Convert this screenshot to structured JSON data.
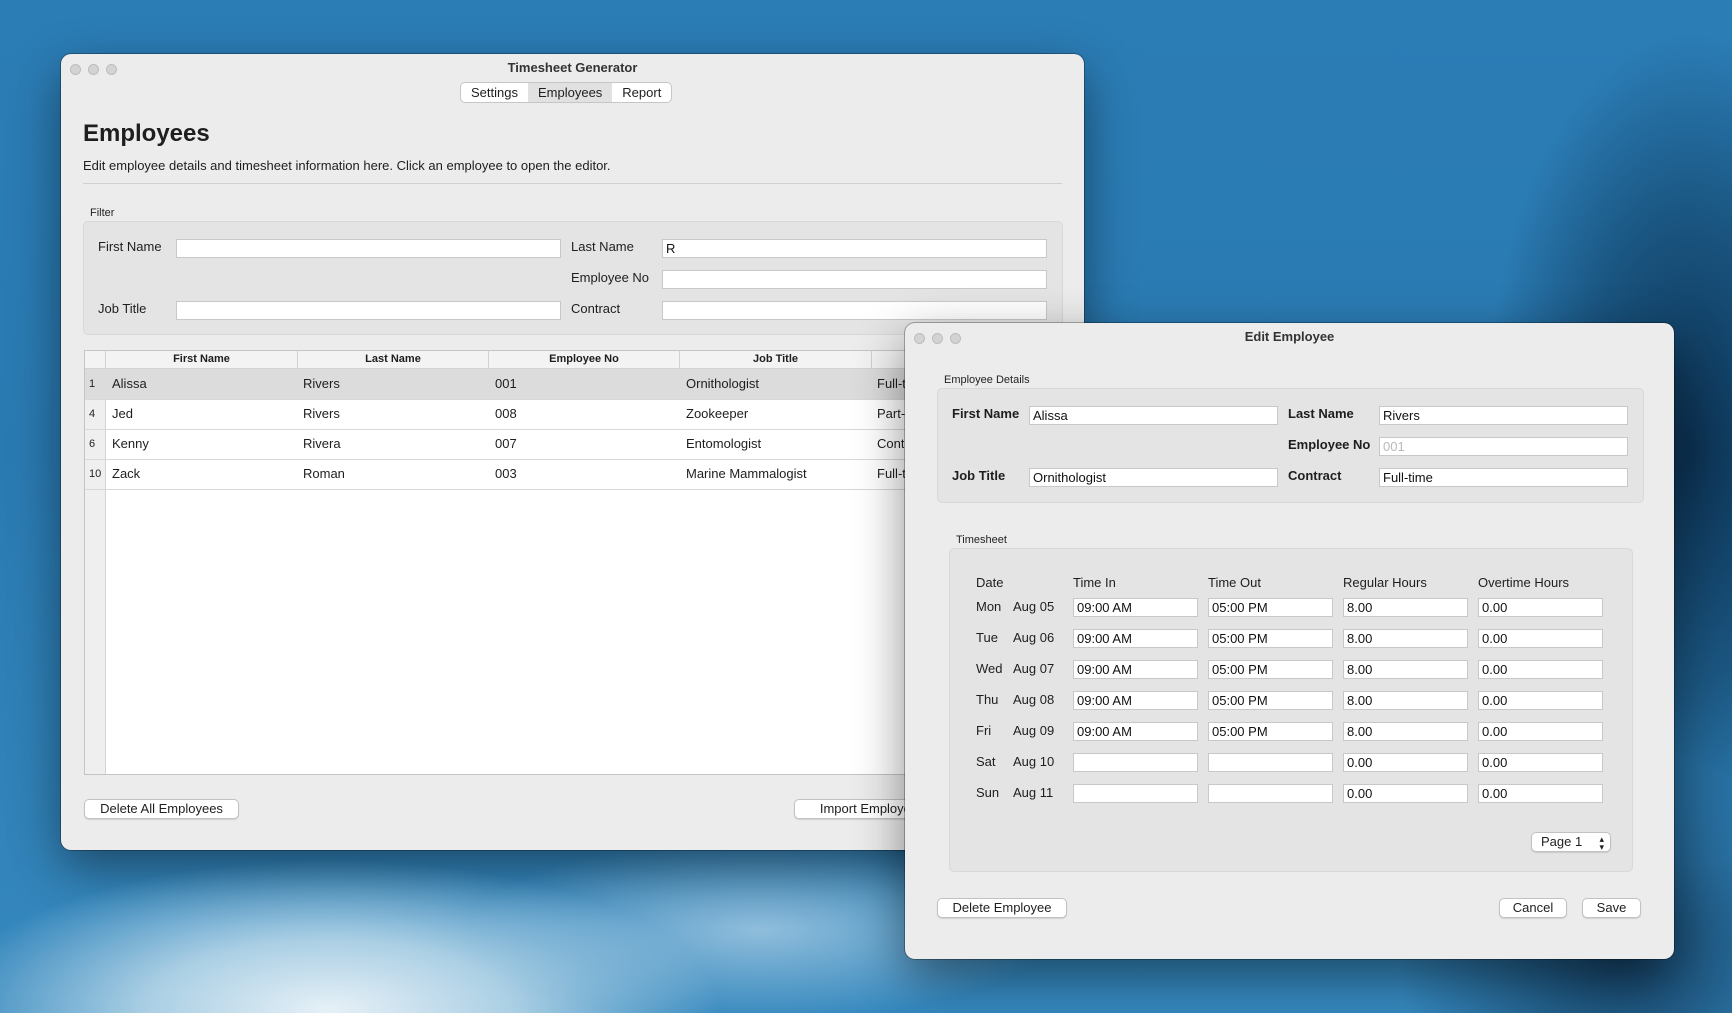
{
  "main_window": {
    "title": "Timesheet Generator",
    "tabs": [
      "Settings",
      "Employees",
      "Report"
    ],
    "selected_tab": "Employees",
    "heading": "Employees",
    "description": "Edit employee details and timesheet information here. Click an employee to open the editor.",
    "filter": {
      "group_label": "Filter",
      "first_name_label": "First Name",
      "first_name_value": "",
      "last_name_label": "Last Name",
      "last_name_value": "R",
      "employee_no_label": "Employee No",
      "employee_no_value": "",
      "job_title_label": "Job Title",
      "job_title_value": "",
      "contract_label": "Contract",
      "contract_value": ""
    },
    "table": {
      "columns": [
        "First Name",
        "Last Name",
        "Employee No",
        "Job Title"
      ],
      "rows": [
        {
          "row_no": "1",
          "first": "Alissa",
          "last": "Rivers",
          "emp_no": "001",
          "job": "Ornithologist",
          "contract": "Full-t"
        },
        {
          "row_no": "4",
          "first": "Jed",
          "last": "Rivers",
          "emp_no": "008",
          "job": "Zookeeper",
          "contract": "Part-"
        },
        {
          "row_no": "6",
          "first": "Kenny",
          "last": "Rivera",
          "emp_no": "007",
          "job": "Entomologist",
          "contract": "Cont"
        },
        {
          "row_no": "10",
          "first": "Zack",
          "last": "Roman",
          "emp_no": "003",
          "job": "Marine Mammalogist",
          "contract": "Full-t"
        }
      ]
    },
    "delete_all_label": "Delete All Employees",
    "import_label": "Import Employee"
  },
  "edit_window": {
    "title": "Edit Employee",
    "details": {
      "group_label": "Employee Details",
      "first_name_label": "First Name",
      "first_name_value": "Alissa",
      "last_name_label": "Last Name",
      "last_name_value": "Rivers",
      "employee_no_label": "Employee No",
      "employee_no_value": "001",
      "job_title_label": "Job Title",
      "job_title_value": "Ornithologist",
      "contract_label": "Contract",
      "contract_value": "Full-time"
    },
    "timesheet": {
      "group_label": "Timesheet",
      "headers": {
        "date": "Date",
        "time_in": "Time In",
        "time_out": "Time Out",
        "regular": "Regular Hours",
        "overtime": "Overtime Hours"
      },
      "rows": [
        {
          "day": "Mon",
          "date": "Aug 05",
          "time_in": "09:00 AM",
          "time_out": "05:00 PM",
          "regular": "8.00",
          "overtime": "0.00"
        },
        {
          "day": "Tue",
          "date": "Aug 06",
          "time_in": "09:00 AM",
          "time_out": "05:00 PM",
          "regular": "8.00",
          "overtime": "0.00"
        },
        {
          "day": "Wed",
          "date": "Aug 07",
          "time_in": "09:00 AM",
          "time_out": "05:00 PM",
          "regular": "8.00",
          "overtime": "0.00"
        },
        {
          "day": "Thu",
          "date": "Aug 08",
          "time_in": "09:00 AM",
          "time_out": "05:00 PM",
          "regular": "8.00",
          "overtime": "0.00"
        },
        {
          "day": "Fri",
          "date": "Aug 09",
          "time_in": "09:00 AM",
          "time_out": "05:00 PM",
          "regular": "8.00",
          "overtime": "0.00"
        },
        {
          "day": "Sat",
          "date": "Aug 10",
          "time_in": "",
          "time_out": "",
          "regular": "0.00",
          "overtime": "0.00"
        },
        {
          "day": "Sun",
          "date": "Aug 11",
          "time_in": "",
          "time_out": "",
          "regular": "0.00",
          "overtime": "0.00"
        }
      ],
      "page_select": "Page 1"
    },
    "delete_label": "Delete Employee",
    "cancel_label": "Cancel",
    "save_label": "Save"
  }
}
